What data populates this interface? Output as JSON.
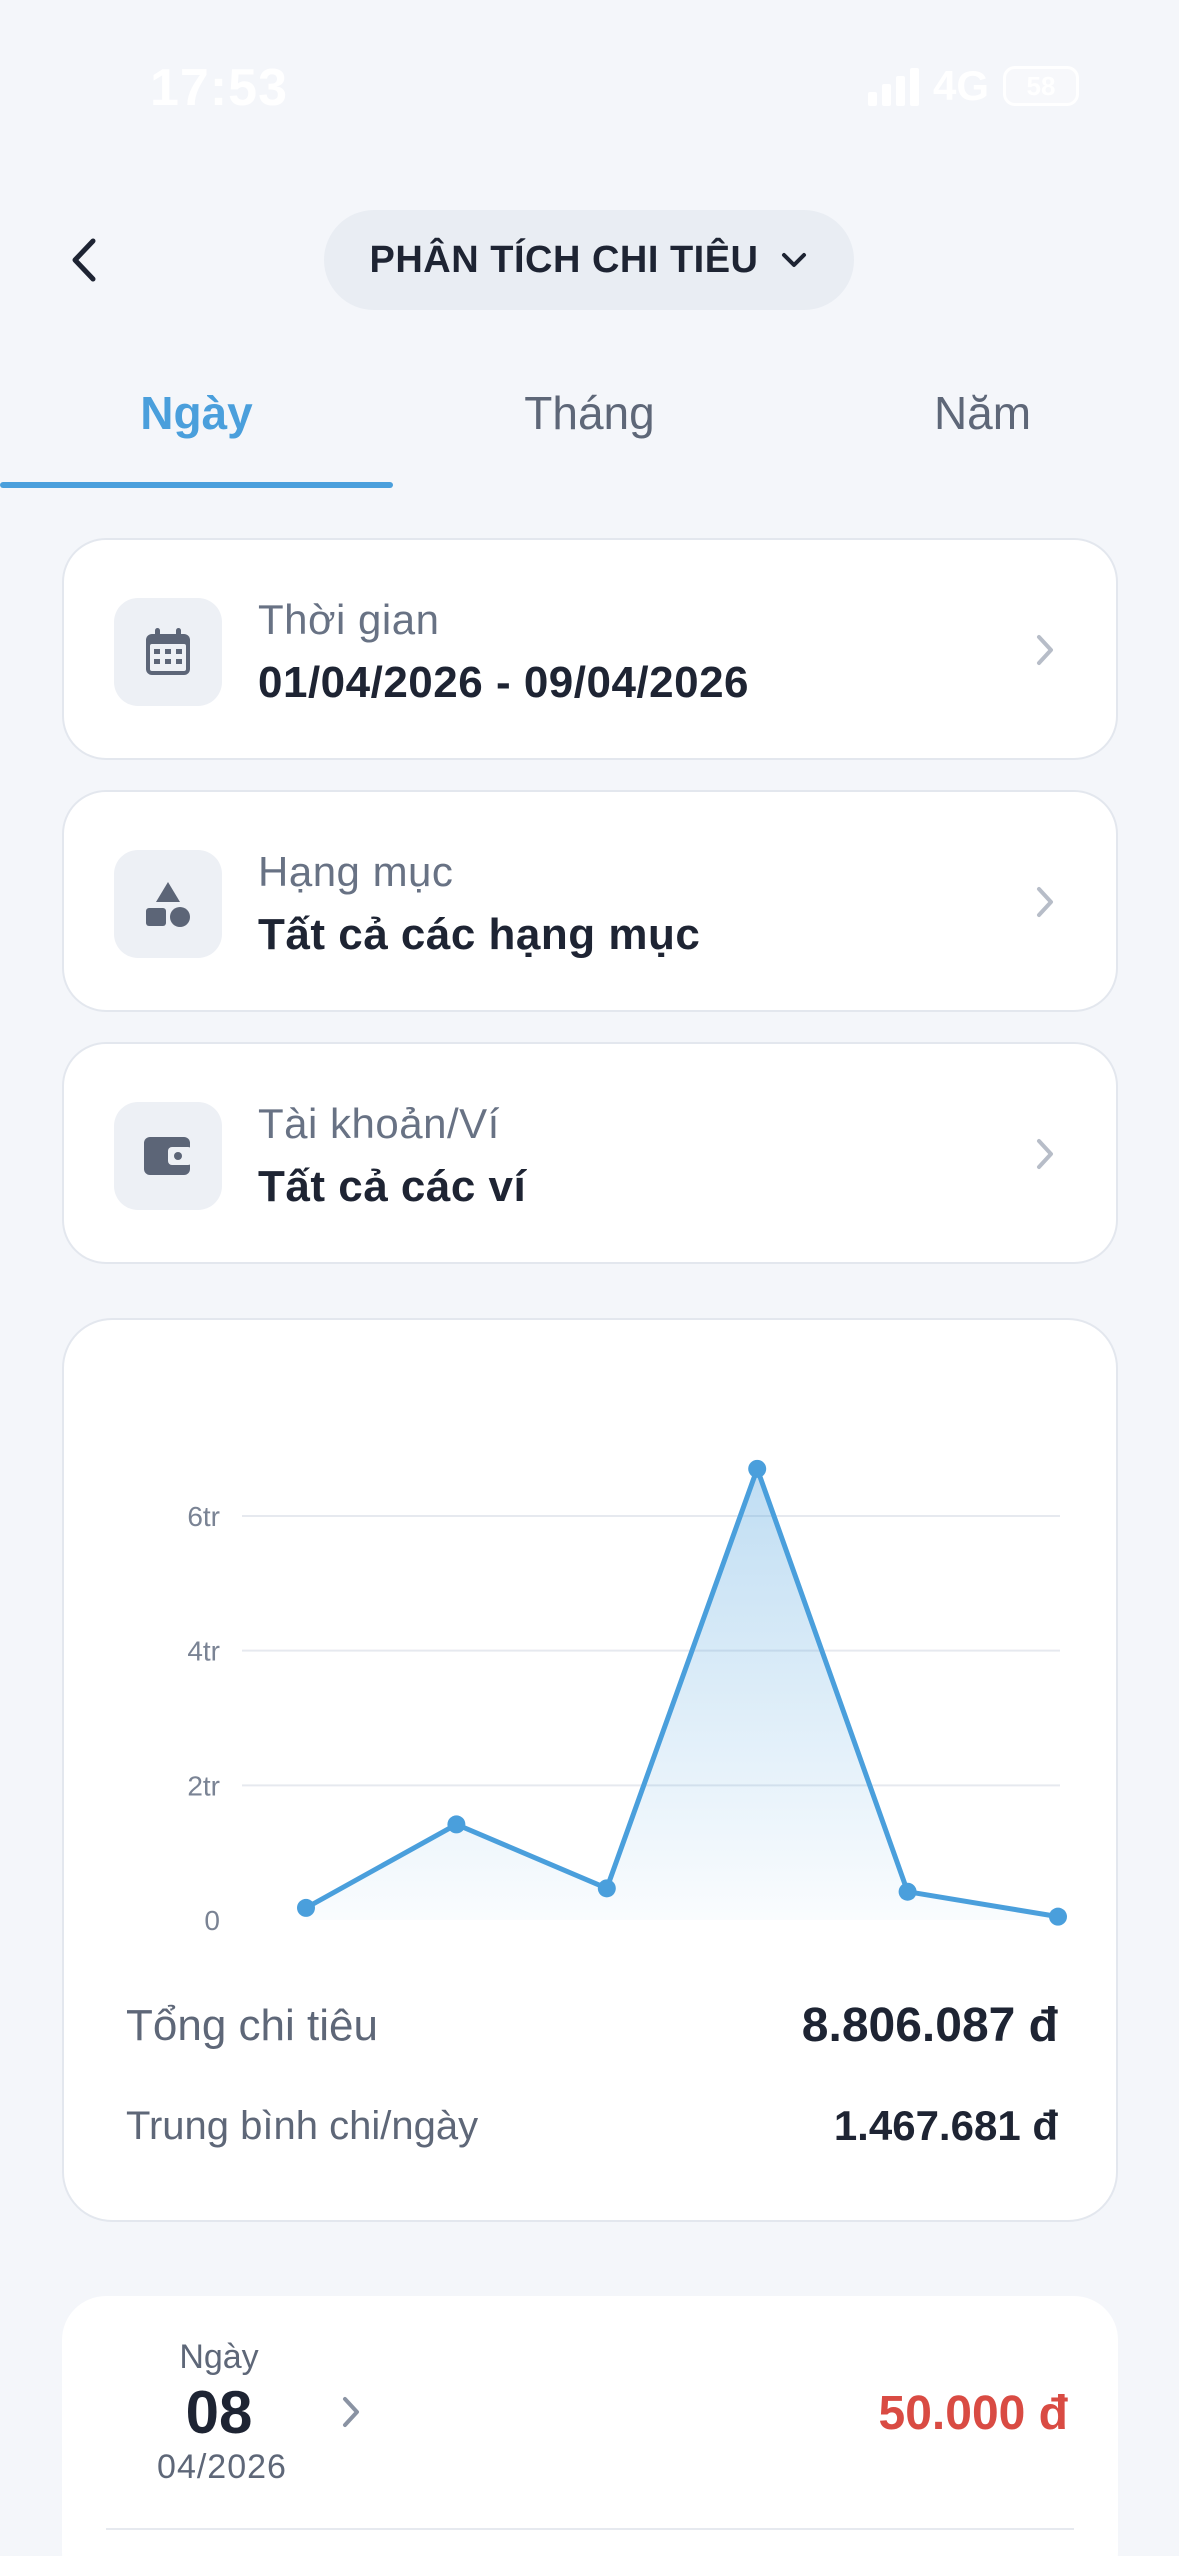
{
  "status_bar": {
    "time": "17:53",
    "network": "4G",
    "battery": "58"
  },
  "header": {
    "title": "PHÂN TÍCH CHI TIÊU"
  },
  "tabs": [
    {
      "label": "Ngày",
      "active": true
    },
    {
      "label": "Tháng",
      "active": false
    },
    {
      "label": "Năm",
      "active": false
    }
  ],
  "filters": [
    {
      "label": "Thời gian",
      "value": "01/04/2026 - 09/04/2026",
      "icon": "calendar-icon"
    },
    {
      "label": "Hạng mục",
      "value": "Tất cả các hạng mục",
      "icon": "category-shapes-icon"
    },
    {
      "label": "Tài khoản/Ví",
      "value": "Tất cả các ví",
      "icon": "wallet-icon"
    }
  ],
  "chart_data": {
    "type": "area",
    "title": "",
    "xlabel": "",
    "ylabel": "",
    "y_ticks": [
      "0",
      "2tr",
      "4tr",
      "6tr"
    ],
    "ylim": [
      0,
      6800000
    ],
    "grid": true,
    "color": "#4a9fdc",
    "series": [
      {
        "values": [
          180000,
          1420000,
          470000,
          6700000,
          420000,
          50000
        ]
      }
    ]
  },
  "summary": {
    "total_label": "Tổng chi tiêu",
    "total_value": "8.806.087 đ",
    "avg_label": "Trung bình chi/ngày",
    "avg_value": "1.467.681 đ"
  },
  "day_entry": {
    "label": "Ngày",
    "day": "08",
    "month": "04/2026",
    "amount": "50.000 đ"
  },
  "colors": {
    "accent": "#4a9fdc",
    "expense": "#d94b43",
    "background": "#f4f6fa"
  }
}
